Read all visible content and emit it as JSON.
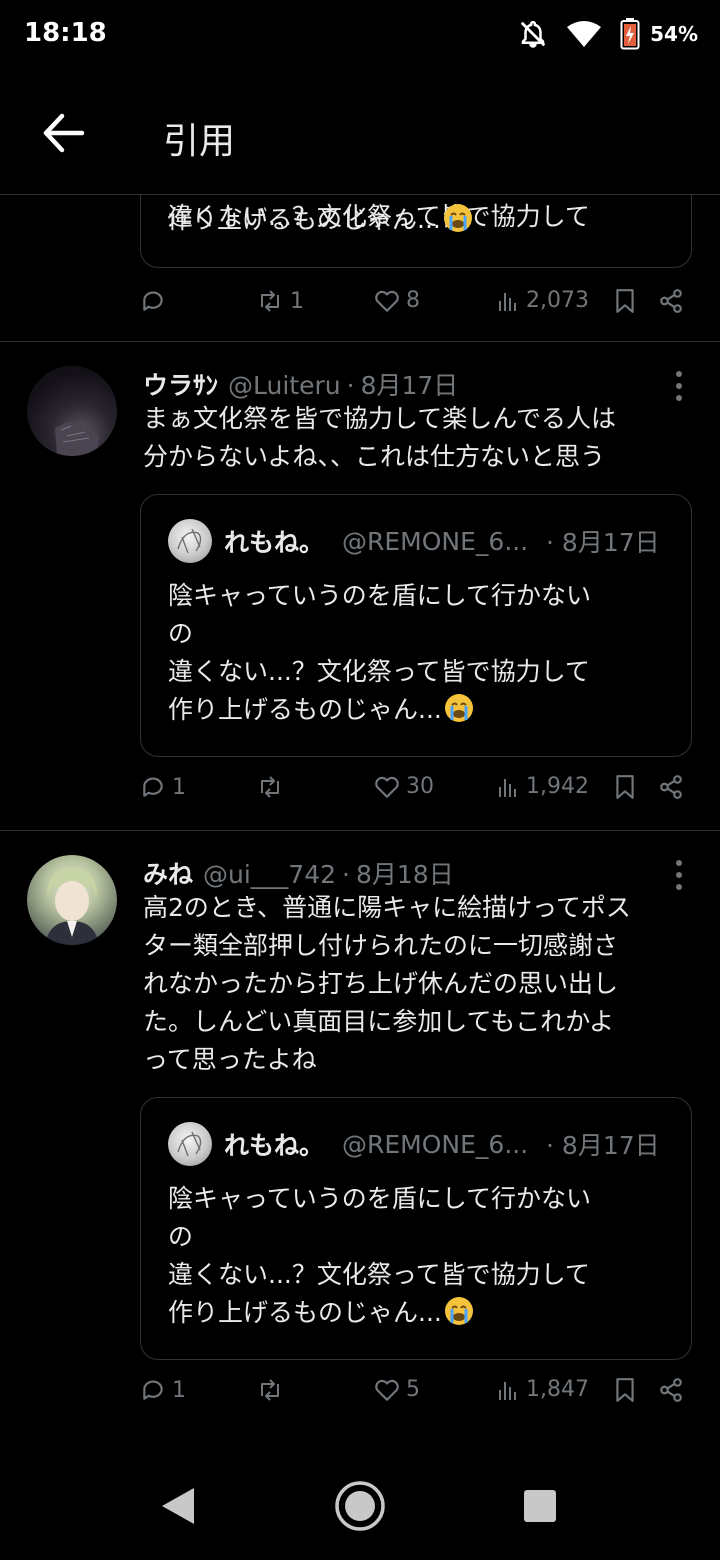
{
  "status_bar": {
    "time": "18:18",
    "battery": "54%"
  },
  "header": {
    "title": "引用"
  },
  "partial_tweet": {
    "quote_lines": [
      "違くない...？文化祭って皆で協力して",
      "作り上げるものじゃん..."
    ],
    "replies": "",
    "retweets": "1",
    "likes": "8",
    "views": "2,073"
  },
  "tweets": [
    {
      "name": "ウラｻﾝ",
      "handle": "@Luiteru",
      "sep": "·",
      "date": "8月17日",
      "text_lines": [
        "まぁ文化祭を皆で協力して楽しんでる人は",
        "分からないよね、、これは仕方ないと思う"
      ],
      "quote": {
        "name": "れもね。",
        "handle": "@REMONE_6...",
        "date": "· 8月17日",
        "lines": [
          "陰キャっていうのを盾にして行かない",
          "の",
          "違くない...？文化祭って皆で協力して",
          "作り上げるものじゃん..."
        ]
      },
      "replies": "1",
      "retweets": "",
      "likes": "30",
      "views": "1,942"
    },
    {
      "name": "みね",
      "handle": "@ui___742",
      "sep": "·",
      "date": "8月18日",
      "text_lines": [
        "高2のとき、普通に陽キャに絵描けってポス",
        "ター類全部押し付けられたのに一切感謝さ",
        "れなかったから打ち上げ休んだの思い出し",
        "た。しんどい真面目に参加してもこれかよ",
        "って思ったよね"
      ],
      "quote": {
        "name": "れもね。",
        "handle": "@REMONE_6...",
        "date": "· 8月17日",
        "lines": [
          "陰キャっていうのを盾にして行かない",
          "の",
          "違くない...？文化祭って皆で協力して",
          "作り上げるものじゃん..."
        ]
      },
      "replies": "1",
      "retweets": "",
      "likes": "5",
      "views": "1,847"
    }
  ],
  "colors": {
    "background": "#000000",
    "text": "#e7e9ea",
    "muted": "#71767b",
    "border": "#2f3336"
  }
}
